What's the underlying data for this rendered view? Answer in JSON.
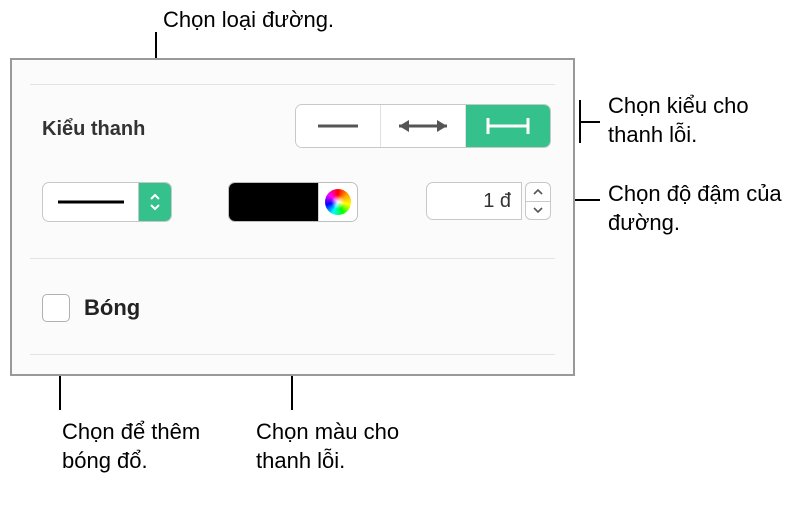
{
  "sectionTitle": "Kiểu thanh",
  "strokeWidthValue": "1 đ",
  "shadowLabel": "Bóng",
  "callouts": {
    "lineType": "Chọn loại đường.",
    "barStyle": "Chọn kiểu cho thanh lỗi.",
    "strokeWidth": "Chọn độ đậm của đường.",
    "addShadow1": "Chọn để thêm",
    "addShadow2": "bóng đổ.",
    "barColor1": "Chọn màu cho",
    "barColor2": "thanh lỗi."
  },
  "icons": {
    "lineTypeDropdown": "double-chevron-icon",
    "colorWheel": "color-wheel-icon",
    "stepUp": "chevron-up-icon",
    "stepDown": "chevron-down-icon"
  }
}
